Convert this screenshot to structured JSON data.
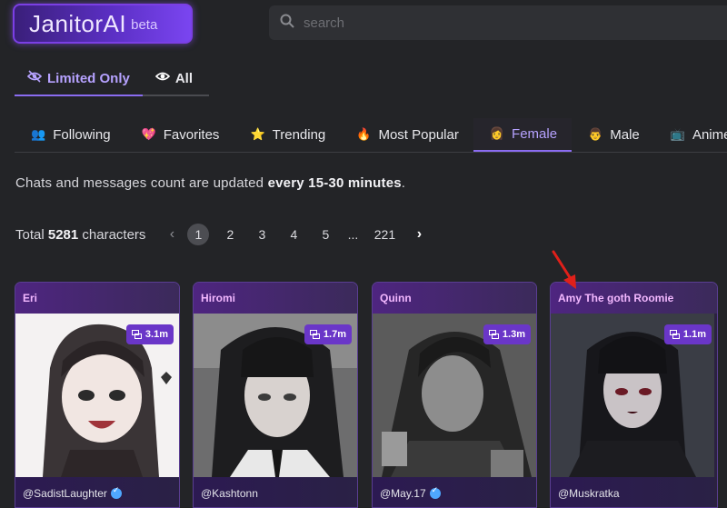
{
  "header": {
    "logo_text": "JanitorAI",
    "logo_badge": "beta",
    "search_placeholder": "search"
  },
  "filter_tabs": [
    {
      "label": "Limited Only",
      "icon": "eye-slash-icon",
      "active": true
    },
    {
      "label": "All",
      "icon": "eye-icon",
      "active": false
    }
  ],
  "category_tabs": [
    {
      "label": "Following",
      "icon": "people-icon",
      "emoji": "👥"
    },
    {
      "label": "Favorites",
      "icon": "heart-icon",
      "emoji": "💖"
    },
    {
      "label": "Trending",
      "icon": "star-icon",
      "emoji": "⭐"
    },
    {
      "label": "Most Popular",
      "icon": "fire-icon",
      "emoji": "🔥"
    },
    {
      "label": "Female",
      "icon": "woman-icon",
      "emoji": "👩",
      "active": true
    },
    {
      "label": "Male",
      "icon": "man-icon",
      "emoji": "👨"
    },
    {
      "label": "Anime",
      "icon": "tv-icon",
      "emoji": "📺"
    }
  ],
  "info": {
    "prefix": "Chats and messages count are updated ",
    "emphasis": "every 15-30 minutes",
    "suffix": "."
  },
  "pagination": {
    "total_prefix": "Total ",
    "total_count": "5281",
    "total_suffix": " characters",
    "pages": [
      "1",
      "2",
      "3",
      "4",
      "5",
      "...",
      "221"
    ],
    "current": "1"
  },
  "cards": [
    {
      "name": "Eri",
      "count": "3.1m",
      "author": "@SadistLaughter",
      "verified": true
    },
    {
      "name": "Hiromi",
      "count": "1.7m",
      "author": "@Kashtonn",
      "verified": false
    },
    {
      "name": "Quinn",
      "count": "1.3m",
      "author": "@May.17",
      "verified": true
    },
    {
      "name": "Amy The goth Roomie",
      "count": "1.1m",
      "author": "@Muskratka",
      "verified": false
    }
  ],
  "colors": {
    "accent": "#8a6cf0",
    "card_title": "#f3b8ff",
    "badge": "#6a36c8",
    "annotation_arrow": "#e0201a"
  }
}
